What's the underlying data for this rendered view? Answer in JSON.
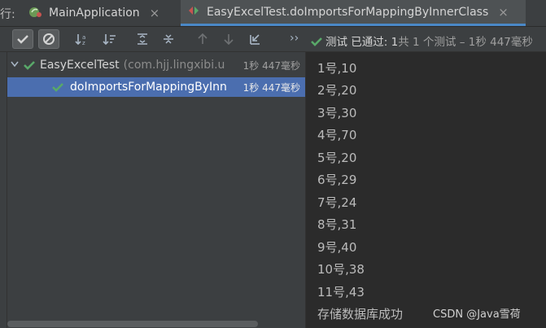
{
  "tabs": {
    "run_label": "行:",
    "items": [
      {
        "label": "MainApplication",
        "close": "×"
      },
      {
        "label": "EasyExcelTest.doImportsForMappingByInnerClass",
        "close": "×"
      }
    ]
  },
  "toolbar": {
    "more": "››",
    "status_prefix": "测试 已通过:",
    "status_count": "1",
    "status_rest": "共 1 个测试 – 1秒 447毫秒"
  },
  "tree": {
    "rows": [
      {
        "name": "EasyExcelTest",
        "pkg": "(com.hjj.lingxibi.u",
        "time": "1秒 447毫秒"
      },
      {
        "name": "doImportsForMappingByInn",
        "time": "1秒 447毫秒"
      }
    ]
  },
  "console": {
    "lines": [
      "1号,10",
      "2号,20",
      "3号,30",
      "4号,70",
      "5号,20",
      "6号,29",
      "7号,24",
      "8号,31",
      "9号,40",
      "10号,38",
      "11号,43",
      "存储数据库成功"
    ],
    "watermark": "CSDN @Java雪荷"
  },
  "colors": {
    "accent": "#4a88c7",
    "selected": "#4b6eaf",
    "pass": "#59a869"
  },
  "icons": [
    "spring-icon",
    "run-test-icon",
    "check-icon",
    "stop-icon",
    "sort-icon",
    "expand-icon",
    "collapse-icon",
    "up-arrow-icon",
    "down-arrow-icon",
    "import-icon"
  ]
}
